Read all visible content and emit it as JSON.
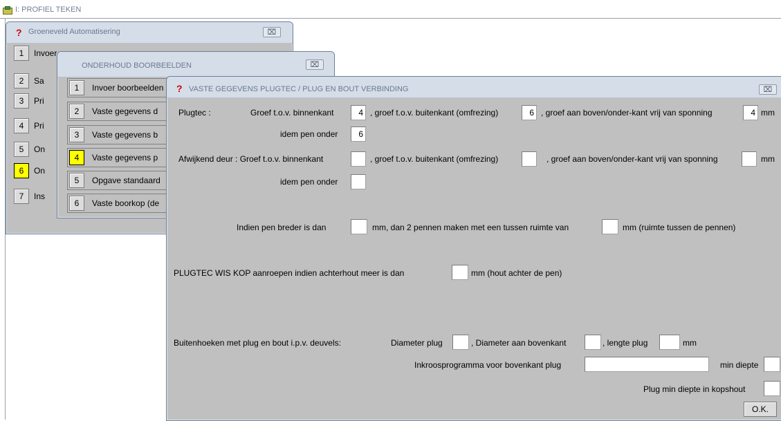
{
  "app": {
    "title": "I: PROFIEL TEKEN"
  },
  "win1": {
    "title": "Groeneveld Automatisering",
    "close": "⌧",
    "items": [
      {
        "num": "1",
        "label": "Invoer"
      },
      {
        "num": "2",
        "label": "Sa"
      },
      {
        "num": "3",
        "label": "Pri"
      },
      {
        "num": "4",
        "label": "Pri"
      },
      {
        "num": "5",
        "label": "On"
      },
      {
        "num": "6",
        "label": "On"
      },
      {
        "num": "7",
        "label": "Ins"
      }
    ]
  },
  "win2": {
    "title": "ONDERHOUD BOORBEELDEN",
    "close": "⌧",
    "items": [
      {
        "num": "1",
        "label": "Invoer boorbeelden"
      },
      {
        "num": "2",
        "label": "Vaste gegevens d"
      },
      {
        "num": "3",
        "label": "Vaste gegevens b"
      },
      {
        "num": "4",
        "label": "Vaste gegevens p"
      },
      {
        "num": "5",
        "label": "Opgave standaard"
      },
      {
        "num": "6",
        "label": "Vaste boorkop (de"
      }
    ]
  },
  "win3": {
    "title": "VASTE GEGEVENS PLUGTEC / PLUG EN BOUT VERBINDING",
    "close": "⌧",
    "plugtec": {
      "label": "Plugtec :",
      "binnen_label": "Groef t.o.v. binnenkant",
      "binnen_value": "4",
      "buiten_label": ", groef t.o.v. buitenkant (omfrezing)",
      "buiten_value": "6",
      "boven_label": ", groef aan boven/onder-kant vrij van sponning",
      "boven_value": "4",
      "unit": "mm",
      "pen_label": "idem pen onder",
      "pen_value": "6"
    },
    "afwijkend": {
      "label": "Afwijkend deur : Groef t.o.v. binnenkant",
      "binnen_value": "",
      "buiten_label": ", groef t.o.v. buitenkant (omfrezing)",
      "buiten_value": "",
      "boven_label": ", groef aan boven/onder-kant vrij van sponning",
      "boven_value": "",
      "unit": "mm",
      "pen_label": "idem pen onder",
      "pen_value": ""
    },
    "pen": {
      "label1": "Indien pen breder is dan",
      "value1": "",
      "label2": "mm, dan 2 pennen maken met een tussen ruimte van",
      "value2": "",
      "label3": "mm (ruimte tussen de pennen)"
    },
    "wiskop": {
      "label1": "PLUGTEC WIS KOP aanroepen indien achterhout meer is dan",
      "value": "",
      "label2": "mm (hout achter de pen)"
    },
    "hoeken": {
      "label": "Buitenhoeken met plug en bout i.p.v. deuvels:",
      "diam_label": "Diameter plug",
      "diam_value": "",
      "boven_label": ", Diameter aan bovenkant",
      "boven_value": "",
      "lengte_label": ", lengte plug",
      "lengte_value": "",
      "unit": "mm",
      "inkroos_label": "Inkroosprogramma voor bovenkant plug",
      "inkroos_value": "",
      "mindiepte_label": "min diepte",
      "mindiepte_value": "",
      "kops_label": "Plug min diepte in kopshout",
      "kops_value": ""
    },
    "ok_label": "O.K."
  }
}
